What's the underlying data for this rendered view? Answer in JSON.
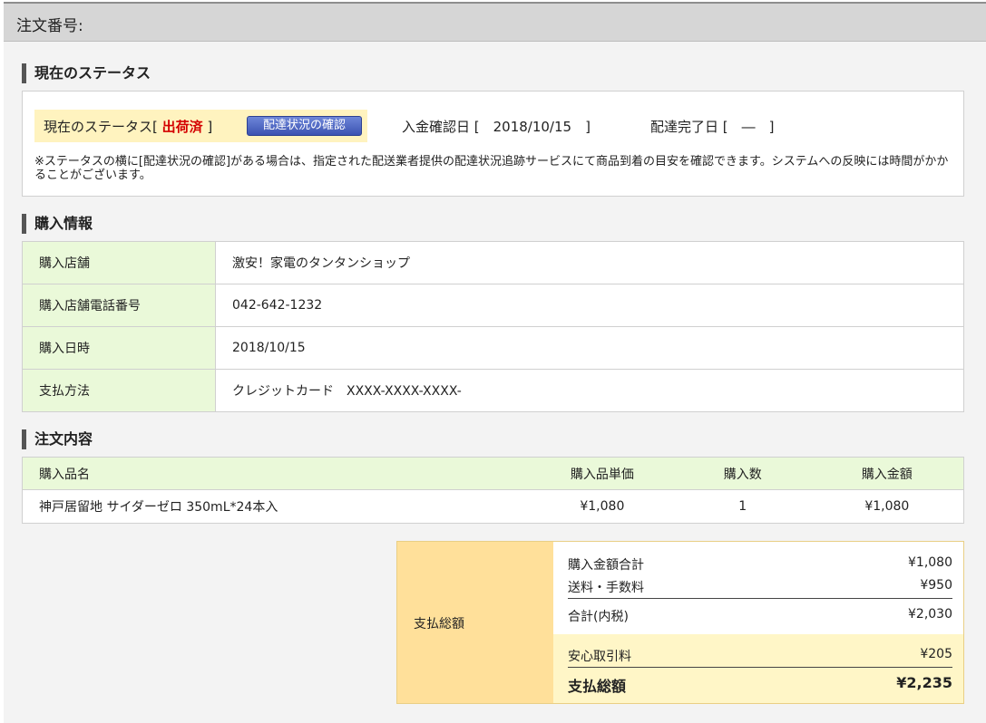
{
  "header": {
    "title": "注文番号:"
  },
  "status_section": {
    "heading": "現在のステータス",
    "status_label_prefix": "現在のステータス[ ",
    "status_value": "出荷済",
    "status_label_suffix": " ]",
    "tracking_button": "配達状況の確認",
    "payment_confirmed_label": "入金確認日 [　2018/10/15　]",
    "delivery_done_label": "配達完了日 [　―　]",
    "note": "※ステータスの横に[配達状況の確認]がある場合は、指定された配送業者提供の配達状況追跡サービスにて商品到着の目安を確認できます。システムへの反映には時間がかかることがございます。"
  },
  "purchase_info": {
    "heading": "購入情報",
    "rows": [
      {
        "label": "購入店舗",
        "value": "激安！家電のタンタンショップ"
      },
      {
        "label": "購入店舗電話番号",
        "value": "042-642-1232"
      },
      {
        "label": "購入日時",
        "value": "2018/10/15"
      },
      {
        "label": "支払方法",
        "value": "クレジットカード　XXXX-XXXX-XXXX-"
      }
    ]
  },
  "order_contents": {
    "heading": "注文内容",
    "columns": [
      "購入品名",
      "購入品単価",
      "購入数",
      "購入金額"
    ],
    "items": [
      {
        "name": "神戸居留地 サイダーゼロ 350mL*24本入",
        "unit_price": "¥1,080",
        "qty": "1",
        "amount": "¥1,080"
      }
    ]
  },
  "summary": {
    "label": "支払総額",
    "subtotal_label": "購入金額合計",
    "subtotal": "¥1,080",
    "shipping_label": "送料・手数料",
    "shipping": "¥950",
    "total_label": "合計(内税)",
    "total": "¥2,030",
    "safety_label": "安心取引料",
    "safety": "¥205",
    "grand_label": "支払総額",
    "grand": "¥2,235"
  },
  "colors": {
    "status_red": "#d40000",
    "label_green": "#eaf9d9",
    "summary_yellow": "#ffe09a",
    "highlight_yellow": "#fff3bf",
    "button_blue": "#3b52b2"
  }
}
